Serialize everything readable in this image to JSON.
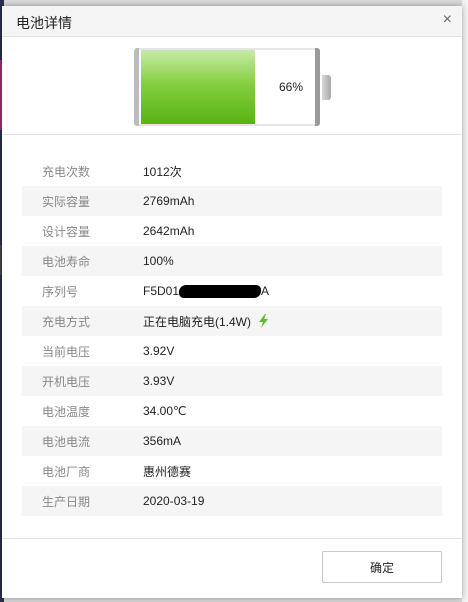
{
  "dialog": {
    "title": "电池详情",
    "close_label": "×",
    "ok_label": "确定"
  },
  "battery": {
    "level_percent": 66,
    "level_label": "66%",
    "fill_color": "#6cc22a"
  },
  "charging_icon": "lightning-bolt-icon",
  "accent_color": "#5fbd25",
  "rows": [
    {
      "label": "充电次数",
      "value": "1012次"
    },
    {
      "label": "实际容量",
      "value": "2769mAh"
    },
    {
      "label": "设计容量",
      "value": "2642mAh"
    },
    {
      "label": "电池寿命",
      "value": "100%"
    },
    {
      "label": "序列号",
      "value_prefix": "F5D01",
      "value_suffix": "A"
    },
    {
      "label": "充电方式",
      "value": "正在电脑充电(1.4W)"
    },
    {
      "label": "当前电压",
      "value": "3.92V"
    },
    {
      "label": "开机电压",
      "value": "3.93V"
    },
    {
      "label": "电池温度",
      "value": "34.00℃"
    },
    {
      "label": "电池电流",
      "value": "356mA"
    },
    {
      "label": "电池厂商",
      "value": "惠州德赛"
    },
    {
      "label": "生产日期",
      "value": "2020-03-19"
    }
  ]
}
